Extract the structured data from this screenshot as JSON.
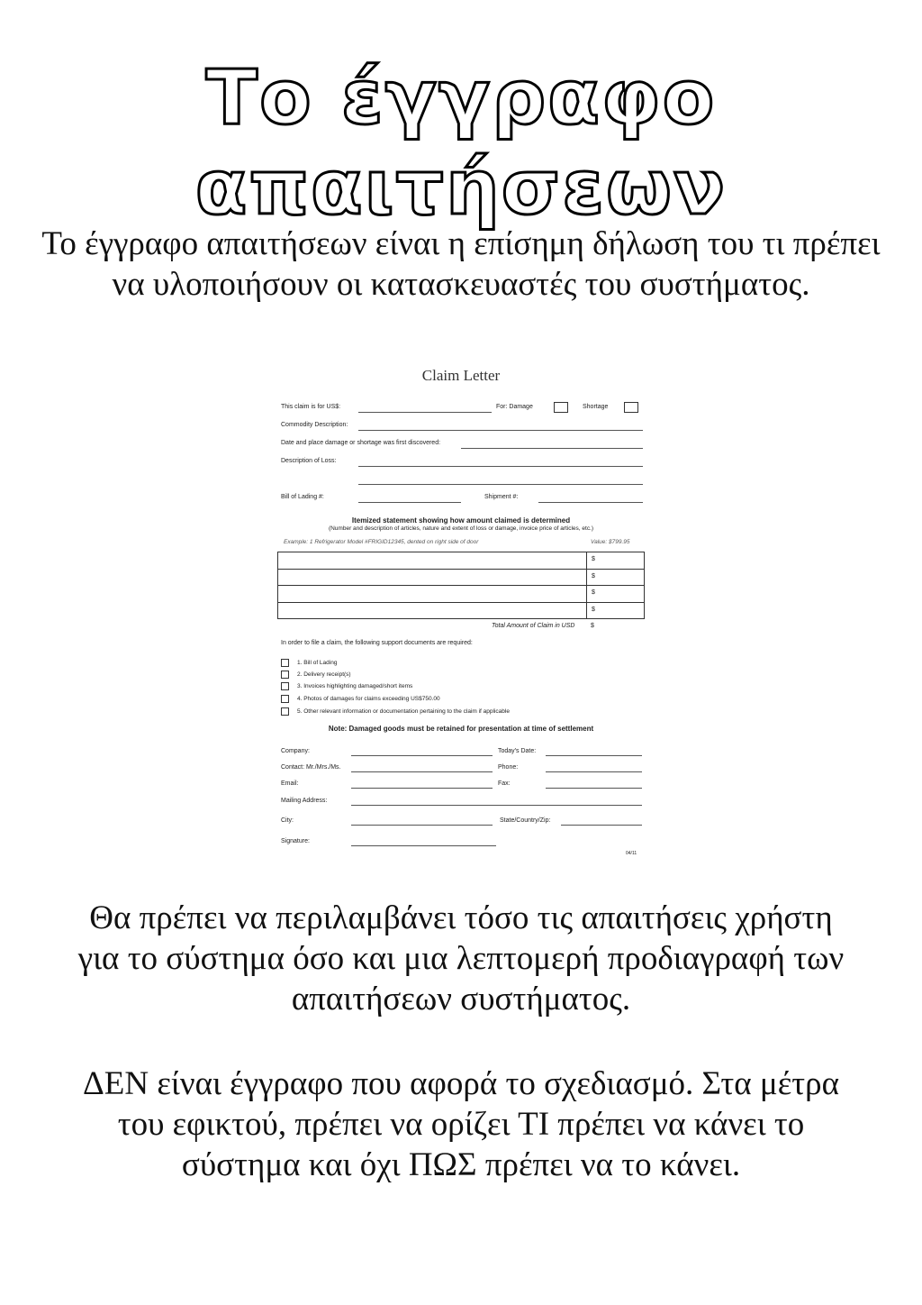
{
  "title": "Το έγγραφο απαιτήσεων",
  "intro": "Το έγγραφο απαιτήσεων είναι η επίσημη δήλωση του τι πρέπει να υλοποιήσουν οι κατασκευαστές του συστήματος.",
  "claim_letter": {
    "title": "Claim Letter",
    "claim_for": "This claim is for US$:",
    "for_damage": "For: Damage",
    "shortage": "Shortage",
    "commodity": "Commodity Description:",
    "date_place": "Date and place damage or shortage was first discovered:",
    "description_loss": "Description of Loss:",
    "bill_of_lading": "Bill of Lading #:",
    "shipment": "Shipment #:",
    "itemized_title": "Itemized statement showing how amount claimed is determined",
    "itemized_sub": "(Number and description of articles, nature and extent of loss or damage, invoice price of articles, etc.)",
    "example": "Example: 1 Refrigerator Model #FRIGID12345, dented on right side of door",
    "example_value": "Value: $799.95",
    "rows": [
      "$",
      "$",
      "$",
      "$"
    ],
    "total_label": "Total Amount of Claim in USD",
    "total_value": "$",
    "docs_intro": "In order to file a claim, the following support documents are required:",
    "docs": [
      "1.   Bill of Lading",
      "2.   Delivery receipt(s)",
      "3.   Invoices highlighting damaged/short items",
      "4.   Photos of damages for claims exceeding US$750.00",
      "5.   Other relevant information or documentation pertaining to the claim if applicable"
    ],
    "note": "Note: Damaged goods must be retained for presentation at time of settlement",
    "company": "Company:",
    "todays_date": "Today's Date:",
    "contact": "Contact: Mr./Mrs./Ms.",
    "phone": "Phone:",
    "email": "Email:",
    "fax": "Fax:",
    "mailing": "Mailing Address:",
    "city": "City:",
    "state": "State/Country/Zip:",
    "signature": "Signature:",
    "version": "04/11"
  },
  "para2": "Θα πρέπει να περιλαμβάνει τόσο τις απαιτήσεις χρήστη για το σύστημα όσο και μια λεπτομερή προδιαγραφή των απαιτήσεων συστήματος.",
  "para3": "ΔΕΝ είναι έγγραφο που αφορά το σχεδιασμό. Στα μέτρα του εφικτού, πρέπει να ορίζει ΤΙ πρέπει να κάνει το σύστημα και όχι ΠΩΣ πρέπει να το κάνει."
}
